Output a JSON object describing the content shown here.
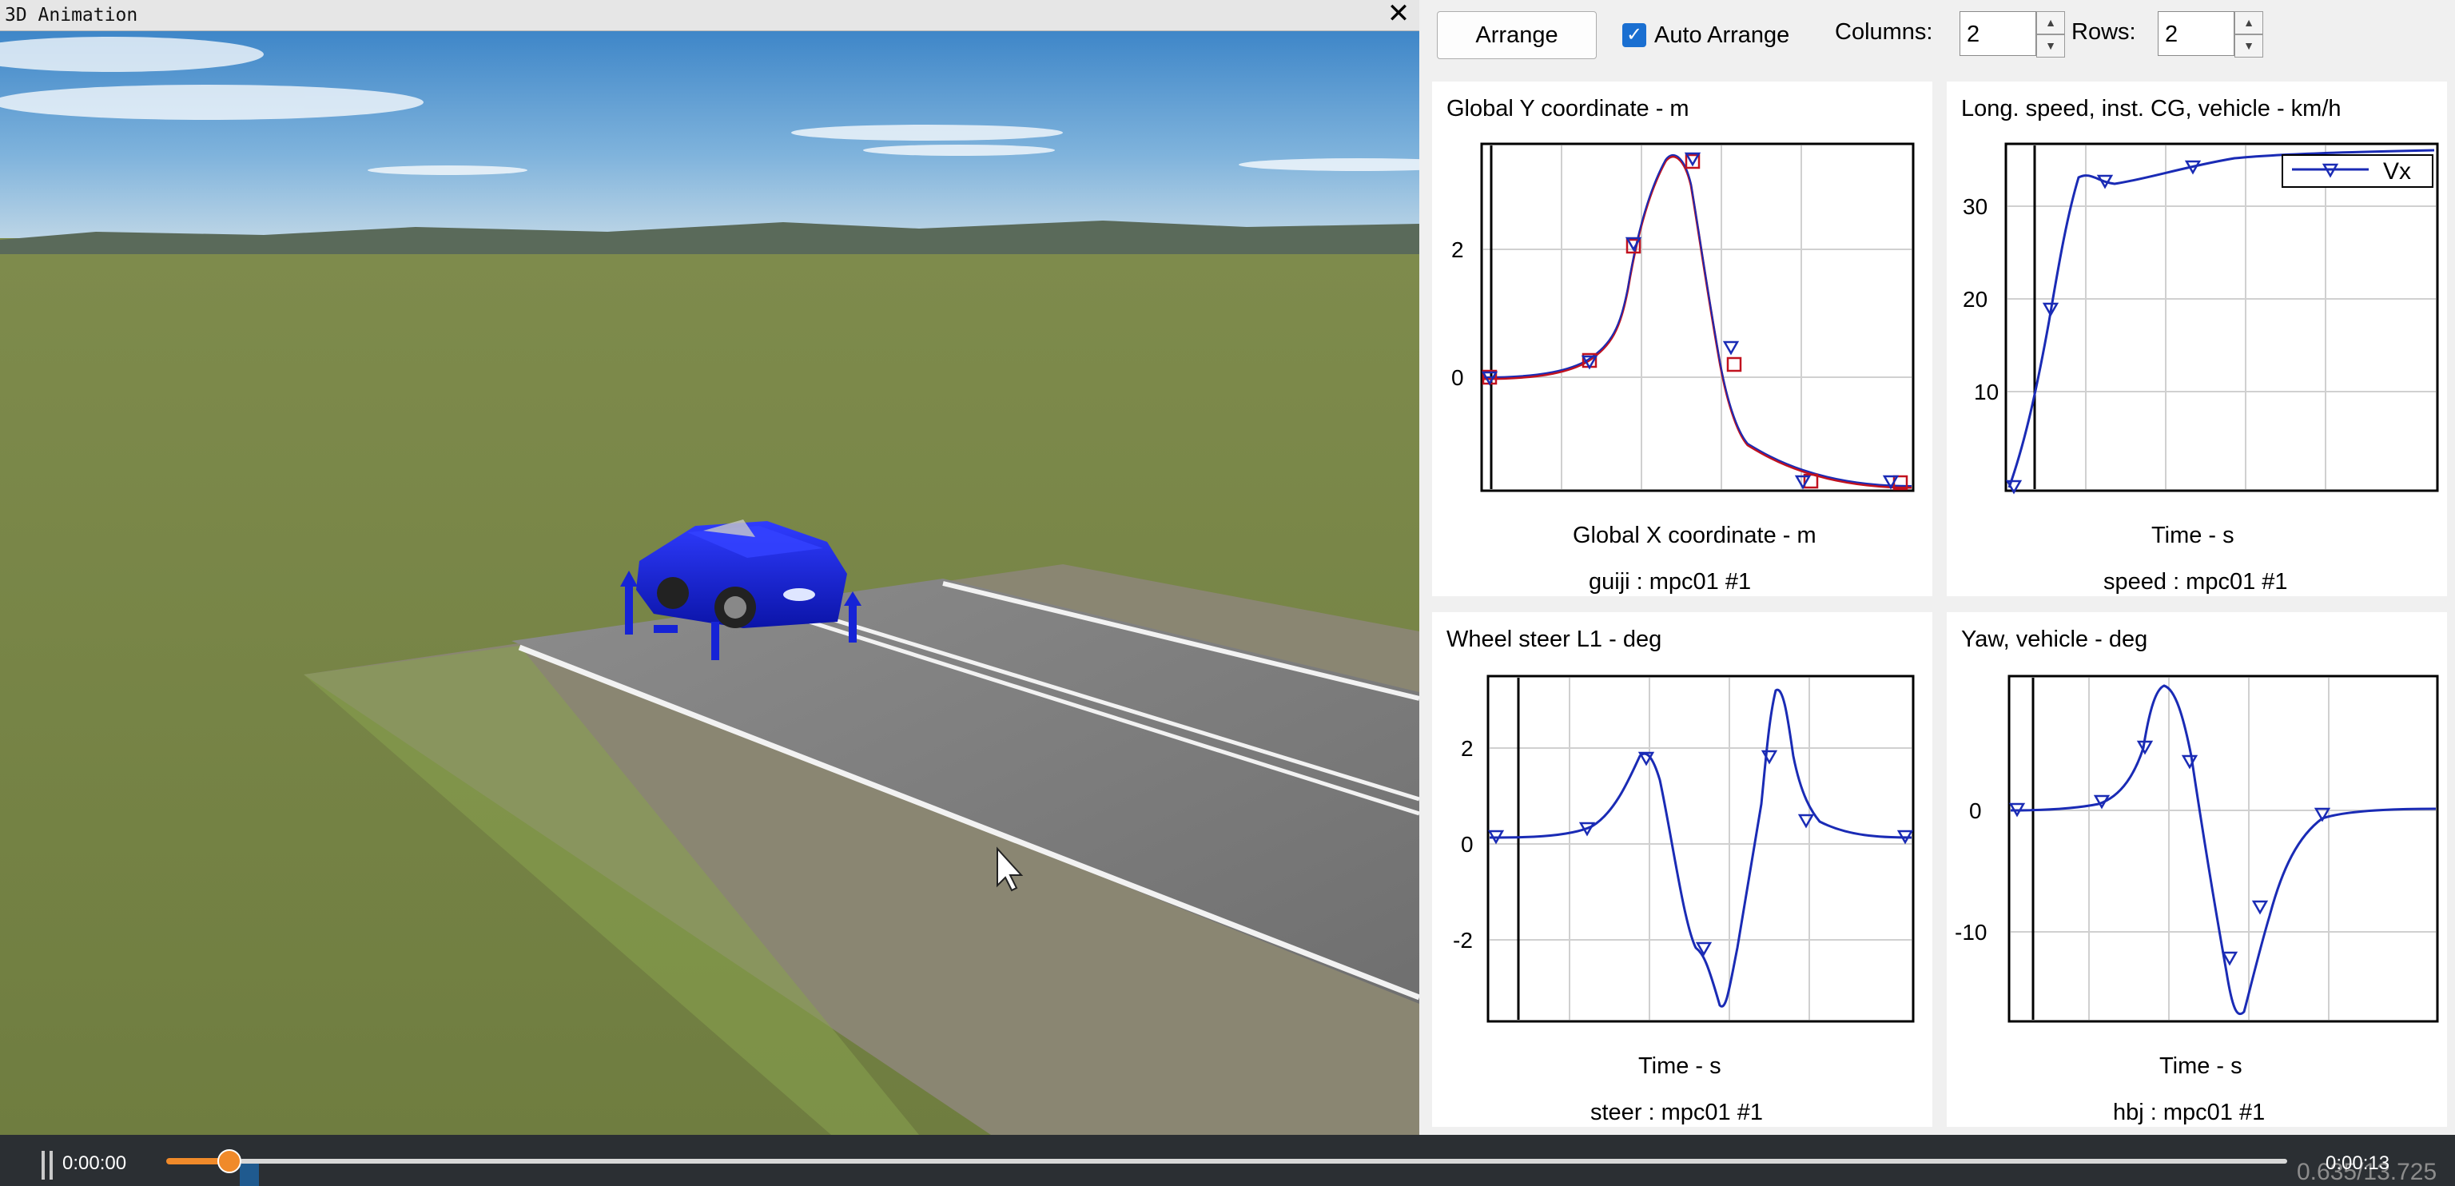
{
  "animation_window": {
    "title": "3D Animation",
    "close_glyph": "✕"
  },
  "toolbar": {
    "arrange_label": "Arrange",
    "auto_arrange_label": "Auto Arrange",
    "auto_arrange_checked": true,
    "columns_label": "Columns:",
    "columns_value": "2",
    "rows_label": "Rows:",
    "rows_value": "2"
  },
  "plots": [
    {
      "title": "Global Y coordinate - m",
      "xlabel": "Global X coordinate - m",
      "dataset": "guiji : mpc01 #1",
      "yticks": [
        "2",
        "0"
      ],
      "series_colors": [
        "#c1121f",
        "#1a2bb5"
      ]
    },
    {
      "title": "Long. speed, inst. CG, vehicle - km/h",
      "xlabel": "Time - s",
      "dataset": "speed : mpc01 #1",
      "yticks": [
        "30",
        "20",
        "10"
      ],
      "legend": "Vx",
      "series_colors": [
        "#1a2bb5"
      ]
    },
    {
      "title": "Wheel steer L1 - deg",
      "xlabel": "Time - s",
      "dataset": "steer : mpc01 #1",
      "yticks": [
        "2",
        "0",
        "-2"
      ],
      "series_colors": [
        "#1a2bb5"
      ]
    },
    {
      "title": "Yaw, vehicle - deg",
      "xlabel": "Time - s",
      "dataset": "hbj : mpc01 #1",
      "yticks": [
        "0",
        "-10"
      ],
      "series_colors": [
        "#1a2bb5"
      ]
    }
  ],
  "playback": {
    "time_start": "0:00:00",
    "time_end": "0:00:13",
    "time_readout": "0.635/13.725",
    "progress": 0.046,
    "accent_color": "#f08a2a"
  }
}
